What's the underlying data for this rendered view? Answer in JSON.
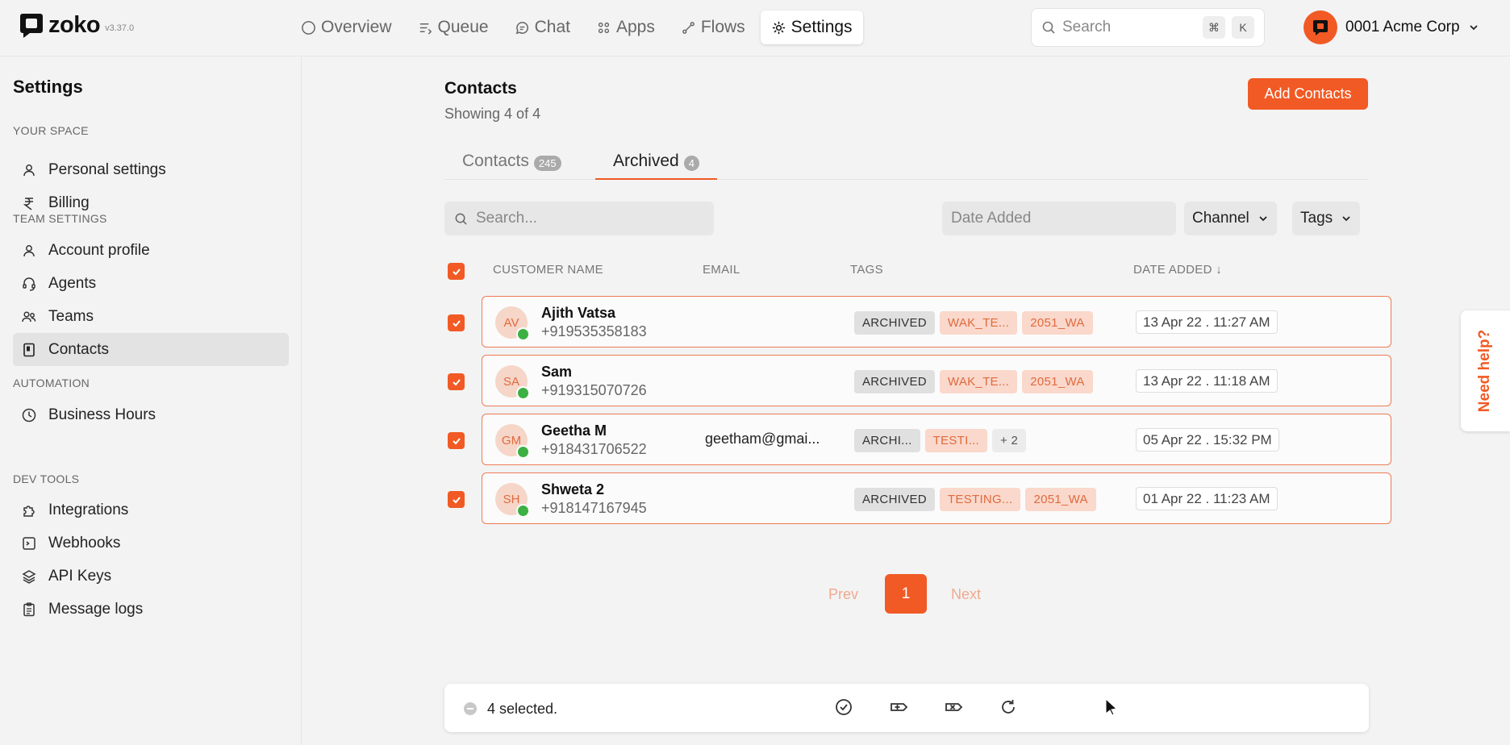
{
  "app": {
    "logo": "zoko",
    "version": "v3.37.0"
  },
  "nav": [
    {
      "label": "Overview",
      "icon": "circle-icon"
    },
    {
      "label": "Queue",
      "icon": "queue-icon"
    },
    {
      "label": "Chat",
      "icon": "chat-icon"
    },
    {
      "label": "Apps",
      "icon": "apps-icon"
    },
    {
      "label": "Flows",
      "icon": "flows-icon"
    },
    {
      "label": "Settings",
      "icon": "gear-icon",
      "active": true
    }
  ],
  "top_search": {
    "placeholder": "Search",
    "kbd1": "⌘",
    "kbd2": "K"
  },
  "account": {
    "name": "0001 Acme Corp"
  },
  "sidebar": {
    "title": "Settings",
    "sections": [
      {
        "label": "YOUR SPACE",
        "items": [
          {
            "label": "Personal settings"
          },
          {
            "label": "Billing"
          }
        ]
      },
      {
        "label": "TEAM SETTINGS",
        "items": [
          {
            "label": "Account profile"
          },
          {
            "label": "Agents"
          },
          {
            "label": "Teams"
          },
          {
            "label": "Contacts",
            "active": true
          }
        ]
      },
      {
        "label": "AUTOMATION",
        "items": [
          {
            "label": "Business Hours"
          }
        ]
      },
      {
        "label": "DEV TOOLS",
        "items": [
          {
            "label": "Integrations"
          },
          {
            "label": "Webhooks"
          },
          {
            "label": "API Keys"
          },
          {
            "label": "Message logs"
          }
        ]
      }
    ]
  },
  "main": {
    "title": "Contacts",
    "subtitle": "Showing 4 of 4",
    "add_button": "Add Contacts",
    "tabs": [
      {
        "label": "Contacts",
        "count": "245"
      },
      {
        "label": "Archived",
        "count": "4",
        "active": true
      }
    ],
    "search_placeholder": "Search...",
    "date_placeholder": "Date Added",
    "channel_filter": "Channel",
    "tags_filter": "Tags",
    "columns": {
      "name": "CUSTOMER NAME",
      "email": "EMAIL",
      "tags": "TAGS",
      "date": "DATE ADDED ↓"
    }
  },
  "rows": [
    {
      "initials": "AV",
      "name": "Ajith Vatsa",
      "phone": "+919535358183",
      "email": "",
      "tags": [
        "ARCHIVED",
        "WAK_TE...",
        "2051_WA"
      ],
      "date": "13 Apr 22 . 11:27 AM"
    },
    {
      "initials": "SA",
      "name": "Sam",
      "phone": "+919315070726",
      "email": "",
      "tags": [
        "ARCHIVED",
        "WAK_TE...",
        "2051_WA"
      ],
      "date": "13 Apr 22 . 11:18 AM"
    },
    {
      "initials": "GM",
      "name": "Geetha M",
      "phone": "+918431706522",
      "email": "geetham@gmai...",
      "tags": [
        "ARCHI...",
        "TESTI...",
        "+ 2"
      ],
      "date": "05 Apr 22 . 15:32 PM"
    },
    {
      "initials": "SH",
      "name": "Shweta 2",
      "phone": "+918147167945",
      "email": "",
      "tags": [
        "ARCHIVED",
        "TESTING...",
        "2051_WA"
      ],
      "date": "01 Apr 22 . 11:23 AM"
    }
  ],
  "pagination": {
    "prev": "Prev",
    "current": "1",
    "next": "Next"
  },
  "bulk_bar": {
    "selected": "4 selected."
  },
  "help": {
    "label": "Need help?"
  },
  "colors": {
    "accent": "#f15a24",
    "whatsapp": "#3cb043"
  }
}
